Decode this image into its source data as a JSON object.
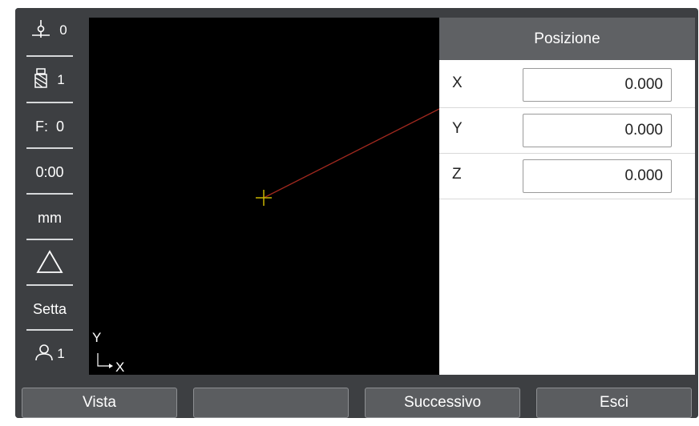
{
  "sidebar": {
    "datum": {
      "icon": "datum-crosshair-icon",
      "value": "0"
    },
    "tool": {
      "icon": "tool-icon",
      "value": "1"
    },
    "feed": {
      "label": "F:",
      "value": "0"
    },
    "timer": {
      "value": "0:00"
    },
    "units": {
      "value": "mm"
    },
    "delta": {
      "icon": "delta-triangle-icon"
    },
    "setup": {
      "label": "Setta"
    },
    "user": {
      "icon": "user-icon",
      "value": "1"
    }
  },
  "graphic": {
    "axis_y": "Y",
    "axis_x": "X",
    "colors": {
      "crosshair": "#c8b400",
      "leader_line": "#a0281e"
    }
  },
  "panel": {
    "title": "Posizione",
    "rows": [
      {
        "axis": "X",
        "value": "0.000"
      },
      {
        "axis": "Y",
        "value": "0.000"
      },
      {
        "axis": "Z",
        "value": "0.000"
      }
    ]
  },
  "softkeys": {
    "view": "Vista",
    "blank": "",
    "next": "Successivo",
    "exit": "Esci"
  }
}
